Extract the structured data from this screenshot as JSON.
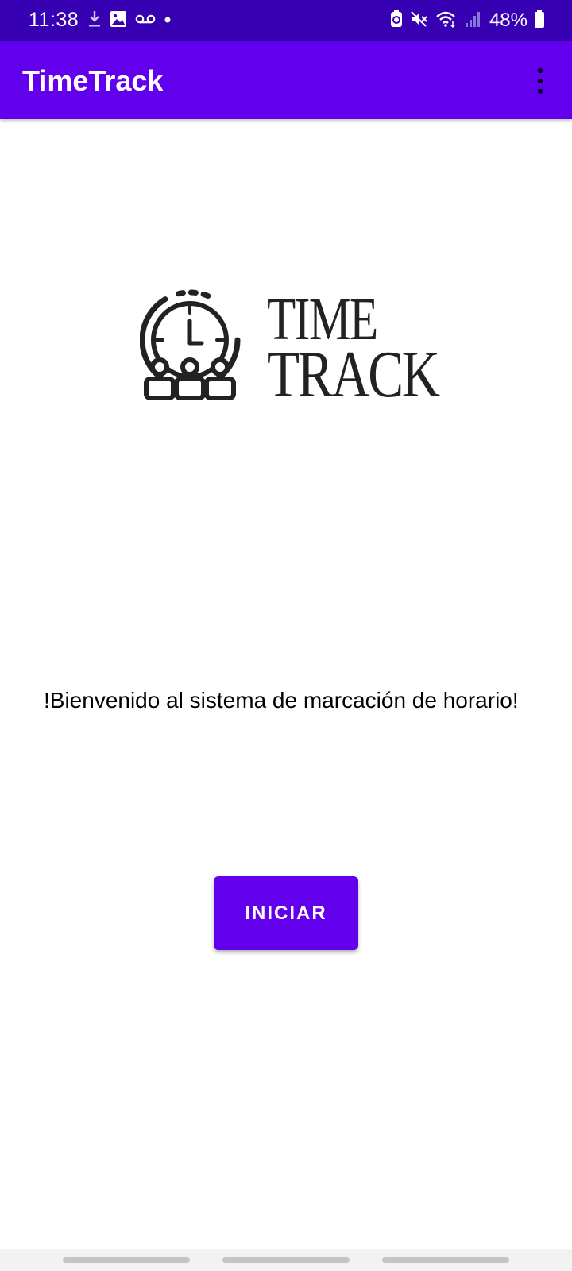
{
  "status_bar": {
    "time": "11:38",
    "battery": "48%",
    "left_icons": [
      "download-icon",
      "gallery-icon",
      "voicemail-icon",
      "notification-dot-icon"
    ],
    "right_icons": [
      "battery-saver-icon",
      "mute-icon",
      "wifi-icon",
      "signal-icon",
      "battery-icon"
    ]
  },
  "app_bar": {
    "title": "TimeTrack",
    "menu_icon": "more-vert-icon"
  },
  "logo": {
    "line1": "TIME",
    "line2": "TRACK",
    "icon": "clock-with-people-icon"
  },
  "main": {
    "welcome": "!Bienvenido al sistema de marcación de horario!",
    "start_button": "INICIAR"
  },
  "colors": {
    "status_bar": "#3700b3",
    "primary": "#6200ee",
    "text": "#000000",
    "background": "#ffffff"
  }
}
